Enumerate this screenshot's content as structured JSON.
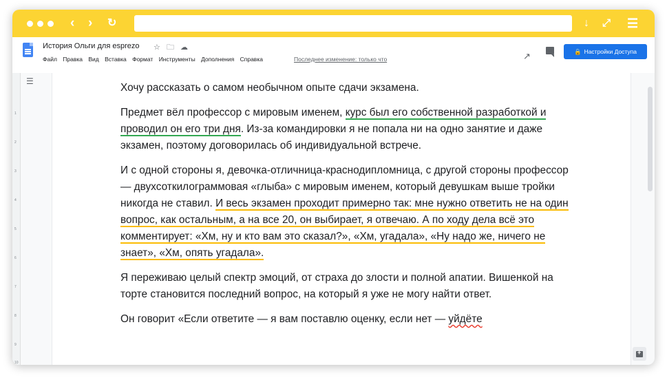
{
  "doc": {
    "title": "История Ольги для esprezo",
    "menu": [
      "Файл",
      "Правка",
      "Вид",
      "Вставка",
      "Формат",
      "Инструменты",
      "Дополнения",
      "Справка"
    ],
    "last_edit": "Последнее изменение: только что",
    "share_label": "Настройки Доступа"
  },
  "ruler_numbers": [
    "1",
    "2",
    "3",
    "4",
    "5",
    "6",
    "7",
    "8",
    "9",
    "10"
  ],
  "paragraphs": {
    "p1": "Хочу рассказать о самом необычном опыте сдачи экзамена.",
    "p2a": "Предмет вёл профессор с мировым именем, ",
    "p2b": "курс был его собственной разработкой и проводил он его три дня",
    "p2c": ". Из-за командировки я не попала ни на одно занятие и даже экзамен, поэтому договорилась об индивидуальной встрече.",
    "p3a": "И с одной стороны я, девочка-отличница-краснодипломница, с другой стороны профессор — двухсоткилограммовая «глыба» с мировым именем, который девушкам выше тройки никогда не ставил. ",
    "p3b": "И весь экзамен проходит примерно так: мне нужно ответить не на один вопрос, как остальным, а на все 20, он выбирает, я отвечаю. А по ходу дела всё это комментирует: «Хм, ну и кто вам это сказал?», «Хм, угадала», «Ну надо же, ничего не знает», «Хм, опять угадала».",
    "p4": "Я переживаю целый спектр эмоций, от страха до злости и полной апатии. Вишенкой на торте становится последний вопрос, на который я уже не могу найти ответ.",
    "p5a": "Он говорит «Если ответите — я вам поставлю оценку, если нет — ",
    "p5b": "уйдёте"
  },
  "colors": {
    "browser_bar": "#fcd433",
    "accent": "#1a73e8",
    "grammar_green": "#33a852",
    "suggestion_yellow": "#fbbc04",
    "spelling_red": "#ea4335"
  },
  "icons": [
    "window-dot-icon",
    "back-icon",
    "forward-icon",
    "reload-icon",
    "download-icon",
    "expand-icon",
    "menu-icon",
    "docs-logo-icon",
    "star-icon",
    "folder-icon",
    "cloud-icon",
    "trend-icon",
    "comment-icon",
    "lock-icon",
    "outline-icon",
    "add-comment-icon"
  ]
}
